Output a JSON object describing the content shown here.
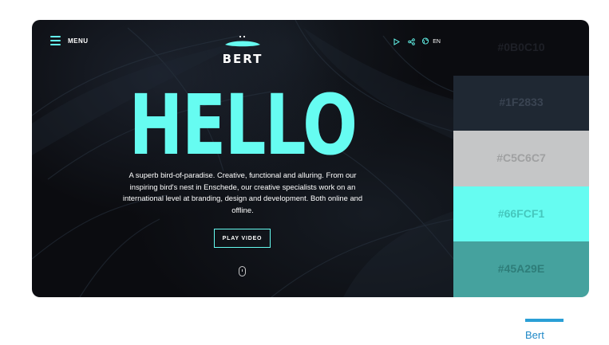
{
  "hero": {
    "menu_label": "MENU",
    "logo_text": "BERT",
    "lang": "EN",
    "headline": "HELLO",
    "description": "A superb bird-of-paradise. Creative, functional and alluring. From our inspiring bird's nest in Enschede, our creative specialists work on an international level at branding, design and development. Both online and offline.",
    "cta": "PLAY VIDEO",
    "icons": [
      "menu-icon",
      "play-icon",
      "share-icon",
      "globe-icon",
      "mouse-scroll-icon"
    ]
  },
  "palette": [
    {
      "label": "#0B0C10",
      "bg": "#0b0c10",
      "text": "#1e2027"
    },
    {
      "label": "#1F2833",
      "bg": "#1f2833",
      "text": "#3a4452"
    },
    {
      "label": "#C5C6C7",
      "bg": "#c5c6c7",
      "text": "#9fa0a1"
    },
    {
      "label": "#66FCF1",
      "bg": "#66fcf1",
      "text": "#45c7bd"
    },
    {
      "label": "#45A29E",
      "bg": "#45a29e",
      "text": "#2e7d79"
    }
  ],
  "caption": {
    "text": "Bert",
    "accent": "#2a9fd6"
  }
}
